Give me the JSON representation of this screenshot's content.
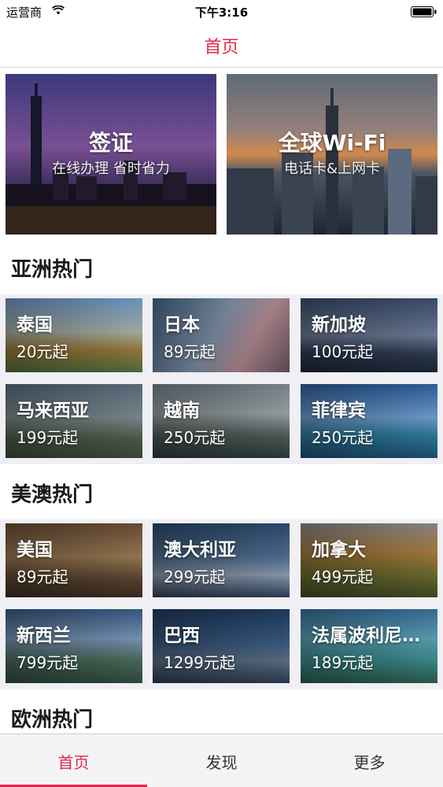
{
  "status_bar": {
    "carrier": "运营商",
    "time": "下午3:16"
  },
  "nav": {
    "title": "首页"
  },
  "banners": [
    {
      "title": "签证",
      "subtitle": "在线办理 省时省力"
    },
    {
      "title": "全球Wi-Fi",
      "subtitle": "电话卡&上网卡"
    }
  ],
  "sections": [
    {
      "title": "亚洲热门",
      "items": [
        {
          "name": "泰国",
          "price": "20元起"
        },
        {
          "name": "日本",
          "price": "89元起"
        },
        {
          "name": "新加坡",
          "price": "100元起"
        },
        {
          "name": "马来西亚",
          "price": "199元起"
        },
        {
          "name": "越南",
          "price": "250元起"
        },
        {
          "name": "菲律宾",
          "price": "250元起"
        }
      ]
    },
    {
      "title": "美澳热门",
      "items": [
        {
          "name": "美国",
          "price": "89元起"
        },
        {
          "name": "澳大利亚",
          "price": "299元起"
        },
        {
          "name": "加拿大",
          "price": "499元起"
        },
        {
          "name": "新西兰",
          "price": "799元起"
        },
        {
          "name": "巴西",
          "price": "1299元起"
        },
        {
          "name": "法属波利尼西亚",
          "price": "189元起"
        }
      ]
    },
    {
      "title": "欧洲热门",
      "items": []
    }
  ],
  "tabs": [
    {
      "label": "首页",
      "active": true
    },
    {
      "label": "发现",
      "active": false
    },
    {
      "label": "更多",
      "active": false
    }
  ],
  "colors": {
    "accent": "#e0294e",
    "separator": "#efeff4"
  }
}
